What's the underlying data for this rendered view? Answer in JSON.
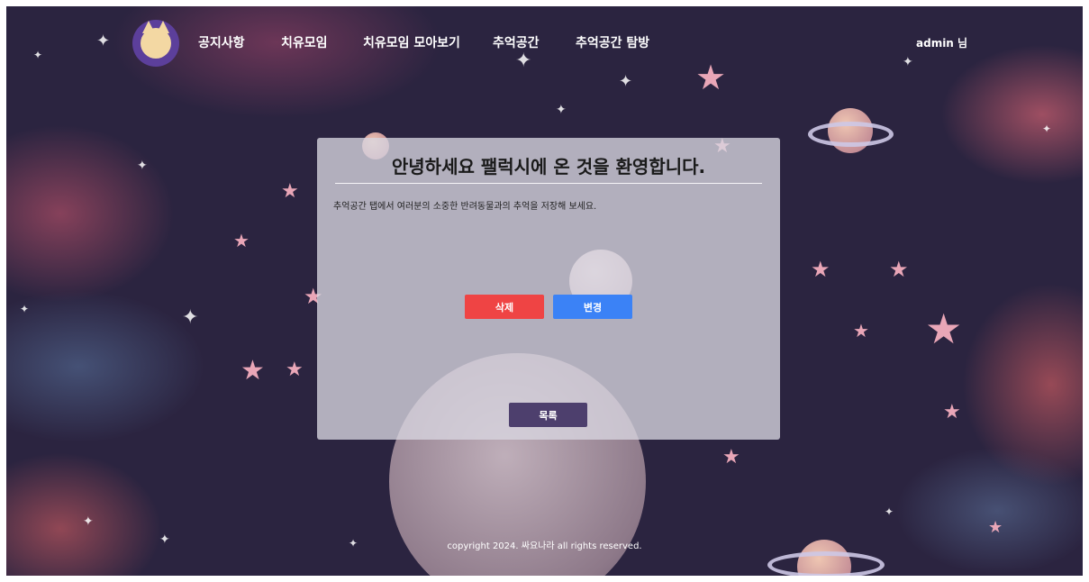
{
  "nav": {
    "items": [
      {
        "label": "공지사항"
      },
      {
        "label": "치유모임"
      },
      {
        "label": "치유모임 모아보기"
      },
      {
        "label": "추억공간"
      },
      {
        "label": "추억공간 탐방"
      }
    ],
    "user": "admin 님"
  },
  "card": {
    "title": "안녕하세요 팰럭시에 온 것을 환영합니다.",
    "text": "추억공간 탭에서 여러분의 소중한 반려동물과의 추억을 저장해 보세요.",
    "delete_label": "삭제",
    "edit_label": "변경",
    "list_label": "목록"
  },
  "footer": {
    "text": "copyright 2024. 싸요나라 all rights reserved."
  },
  "colors": {
    "delete": "#ef4444",
    "edit": "#3b82f6",
    "list": "#4d3f6d",
    "logo": "#5c3f9b"
  }
}
